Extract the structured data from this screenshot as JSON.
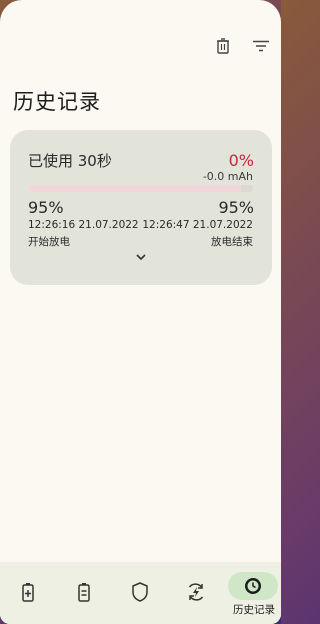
{
  "header": {
    "title": "历史记录",
    "actions": [
      {
        "name": "delete-button",
        "icon": "trash-icon"
      },
      {
        "name": "filter-button",
        "icon": "filter-icon"
      }
    ]
  },
  "record": {
    "used_label": "已使用 30秒",
    "percent_change": "0%",
    "capacity": "-0.0 mAh",
    "start_percent": "95%",
    "end_percent": "95%",
    "start_time": "12:26:16 21.07.2022",
    "end_time": "12:26:47 21.07.2022",
    "start_label": "开始放电",
    "end_label": "放电结束",
    "accent_red": "#c4273f"
  },
  "nav": {
    "items": [
      {
        "icon": "battery-charging-icon"
      },
      {
        "icon": "battery-icon"
      },
      {
        "icon": "shield-icon"
      },
      {
        "icon": "refresh-bolt-icon"
      },
      {
        "icon": "history-icon",
        "label": "历史记录",
        "active": true
      }
    ]
  }
}
